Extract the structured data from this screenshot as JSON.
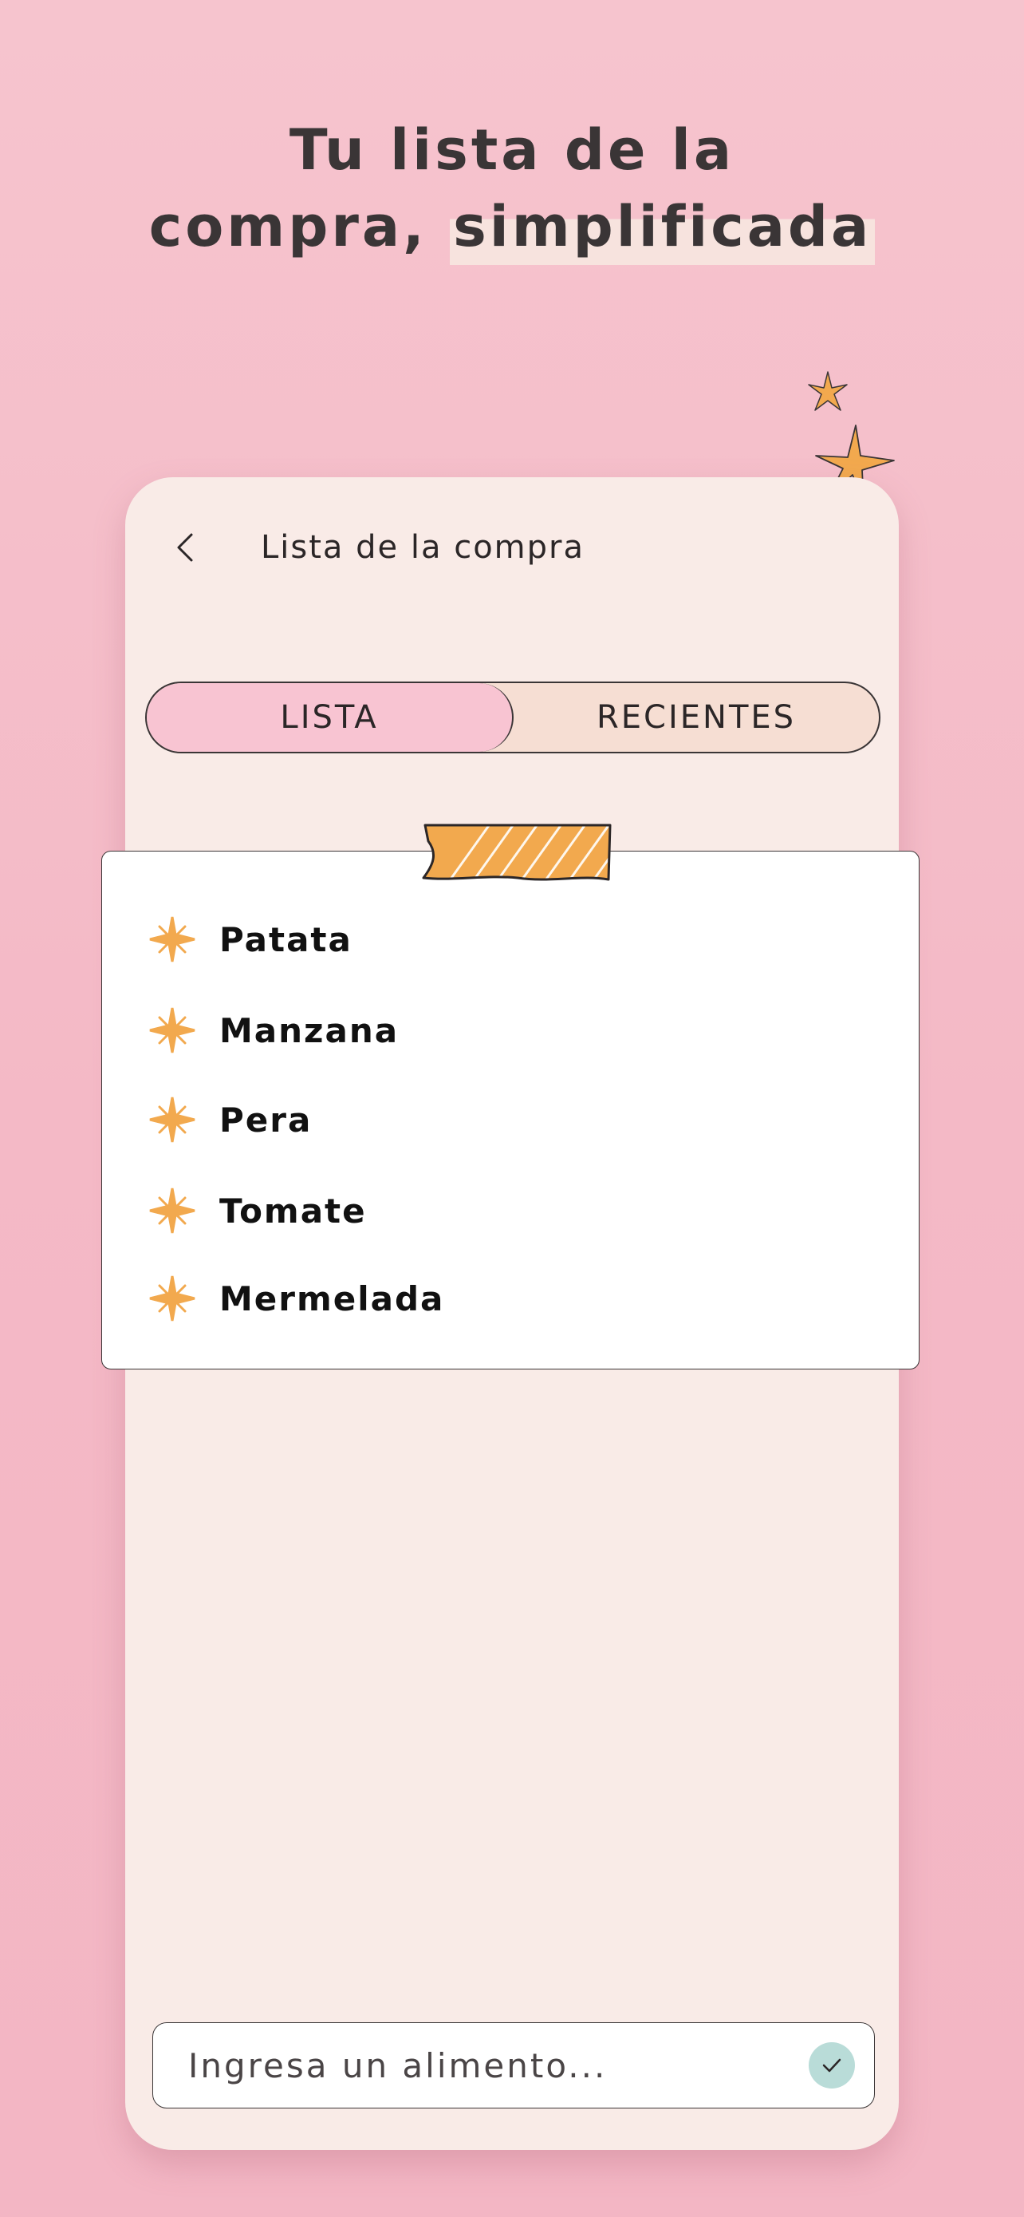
{
  "headline": {
    "line1": "Tu lista de la",
    "line2_prefix": "compra, ",
    "line2_highlight": "simplificada"
  },
  "screen": {
    "title": "Lista de la compra",
    "back_icon": "chevron-left-icon"
  },
  "tabs": [
    {
      "label": "LISTA",
      "active": true
    },
    {
      "label": "RECIENTES",
      "active": false
    }
  ],
  "list": {
    "bullet_icon": "sparkle-bullet-icon",
    "items": [
      {
        "label": "Patata"
      },
      {
        "label": "Manzana"
      },
      {
        "label": "Pera"
      },
      {
        "label": "Tomate"
      },
      {
        "label": "Mermelada"
      }
    ]
  },
  "input": {
    "placeholder": "Ingresa un alimento...",
    "value": "",
    "submit_icon": "check-icon"
  },
  "colors": {
    "background": "#f6c4ce",
    "phone": "#f9ebe7",
    "tab_active": "#f8c4d2",
    "tab_inactive": "#f6ded3",
    "accent_orange": "#f2a94e",
    "check_bg": "#b9dcd8",
    "text_dark": "#3a3536"
  }
}
